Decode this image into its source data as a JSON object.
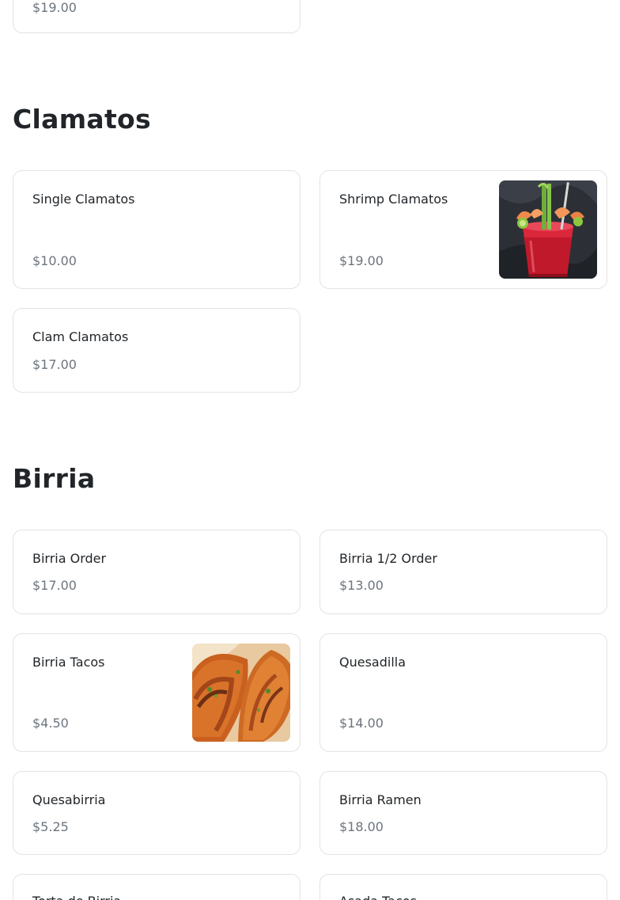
{
  "previous_section": {
    "last_item_price": "$19.00"
  },
  "clamatos": {
    "title": "Clamatos",
    "items": [
      {
        "name": "Single Clamatos",
        "price": "$10.00"
      },
      {
        "name": "Shrimp Clamatos",
        "price": "$19.00",
        "image": "shrimp-clamato-photo"
      },
      {
        "name": "Clam Clamatos",
        "price": "$17.00"
      }
    ]
  },
  "birria": {
    "title": "Birria",
    "items": [
      {
        "name": "Birria Order",
        "price": "$17.00"
      },
      {
        "name": "Birria 1/2 Order",
        "price": "$13.00"
      },
      {
        "name": "Birria Tacos",
        "price": "$4.50",
        "image": "birria-tacos-photo"
      },
      {
        "name": "Quesadilla",
        "price": "$14.00"
      },
      {
        "name": "Quesabirria",
        "price": "$5.25"
      },
      {
        "name": "Birria Ramen",
        "price": "$18.00"
      },
      {
        "name": "Torta de Birria",
        "price": ""
      },
      {
        "name": "Asada Tacos",
        "price": ""
      }
    ]
  },
  "colors": {
    "text": "#212529",
    "muted": "#6c757d",
    "border": "#e3e3e3"
  }
}
